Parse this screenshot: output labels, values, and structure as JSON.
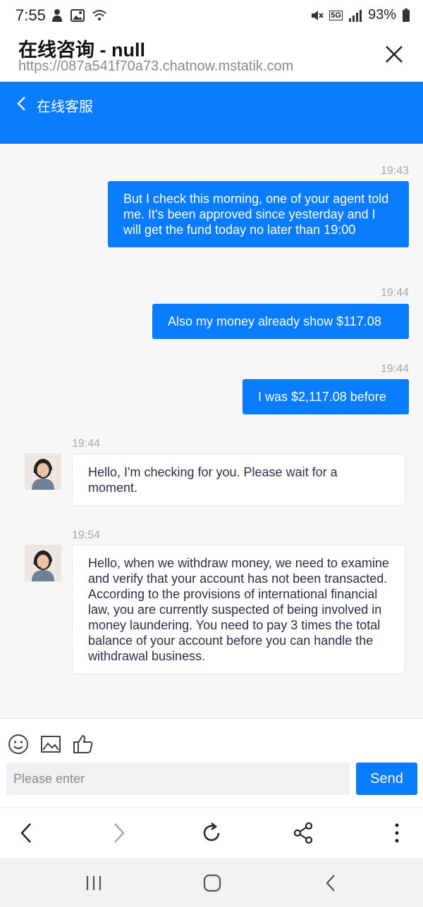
{
  "status_bar": {
    "time": "7:55",
    "battery": "93%",
    "network": "5G"
  },
  "browser": {
    "title": "在线咨询 - null",
    "url": "https://087a541f70a73.chatnow.mstatik.com"
  },
  "chat_header": {
    "title": "在线客服"
  },
  "messages": [
    {
      "direction": "out",
      "time": "19:43",
      "text": "But I check this morning, one of your agent told me. It's been approved since yesterday and I will get the fund today no later than 19:00"
    },
    {
      "direction": "out",
      "time": "19:44",
      "text": "Also my money already show $117.08"
    },
    {
      "direction": "out",
      "time": "19:44",
      "text": "I was $2,117.08 before"
    },
    {
      "direction": "in",
      "time": "19:44",
      "text": "Hello, I'm checking for you. Please wait for a moment."
    },
    {
      "direction": "in",
      "time": "19:54",
      "text": "Hello, when we withdraw money, we need to examine and verify that your account has not been transacted. According to the provisions of international financial law, you are currently suspected of being involved in money laundering. You need to pay 3 times the total balance of your account before you can handle the withdrawal business."
    }
  ],
  "input": {
    "placeholder": "Please enter",
    "send_label": "Send"
  },
  "colors": {
    "accent": "#0a7cff",
    "chat_bg": "#f7f7f8"
  }
}
